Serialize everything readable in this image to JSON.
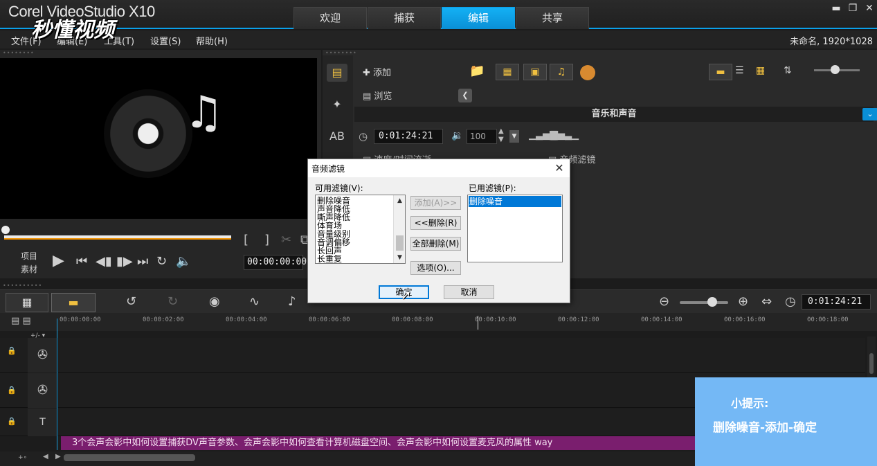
{
  "app": {
    "title": "Corel VideoStudio X10",
    "watermark": "秒懂视频",
    "project_info": "未命名, 1920*1028",
    "window_controls": {
      "minimize": "▬",
      "restore": "❐",
      "close": "✕"
    }
  },
  "main_tabs": [
    {
      "label": "欢迎",
      "active": false
    },
    {
      "label": "捕获",
      "active": false
    },
    {
      "label": "编辑",
      "active": true
    },
    {
      "label": "共享",
      "active": false
    }
  ],
  "menu": [
    {
      "label": "文件(F)"
    },
    {
      "label": "编辑(E)"
    },
    {
      "label": "工具(T)"
    },
    {
      "label": "设置(S)"
    },
    {
      "label": "帮助(H)"
    }
  ],
  "preview": {
    "mode_project": "项目",
    "mode_clip": "素材",
    "timecode": "00:00:00:00",
    "bracket_in": "[",
    "bracket_out": "]"
  },
  "library": {
    "add_label": "添加",
    "browse_label": "浏览",
    "section_title": "音乐和声音",
    "duration_timecode": "0:01:24:21",
    "volume": "100",
    "option_speed": "速度/时间流逝",
    "option_filter": "音频滤镜"
  },
  "timeline": {
    "timecode": "0:01:24:21",
    "ruler_ticks": [
      "00:00:00:00",
      "00:00:02:00",
      "00:00:04:00",
      "00:00:06:00",
      "00:00:08:00",
      "00:00:10:00",
      "00:00:12:00",
      "00:00:14:00",
      "00:00:16:00",
      "00:00:18:00"
    ],
    "marquee_text": "3个会声会影中如何设置捕获DV声音参数、会声会影中如何查看计算机磁盘空间、会声会影中如何设置麦克风的属性 way"
  },
  "dialog": {
    "title": "音频滤镜",
    "available_label": "可用滤镜(V):",
    "applied_label": "已用滤镜(P):",
    "available_filters": [
      "删除噪音",
      "声音降低",
      "嘶声降低",
      "体育场",
      "音量级别",
      "音调偏移",
      "长回声",
      "长重复"
    ],
    "applied_filters": [
      "删除噪音"
    ],
    "add_button": "添加(A)>>",
    "remove_button": "<<删除(R)",
    "remove_all_button": "全部删除(M)",
    "options_button": "选项(O)...",
    "ok_button": "确定",
    "cancel_button": "取消"
  },
  "tip": {
    "title": "小提示:",
    "text": "删除噪音-添加-确定"
  },
  "colors": {
    "accent": "#0aa0ea",
    "tip_bg": "#74b8f5",
    "marquee_bg": "#7a1e6e",
    "selection": "#0078d7"
  }
}
